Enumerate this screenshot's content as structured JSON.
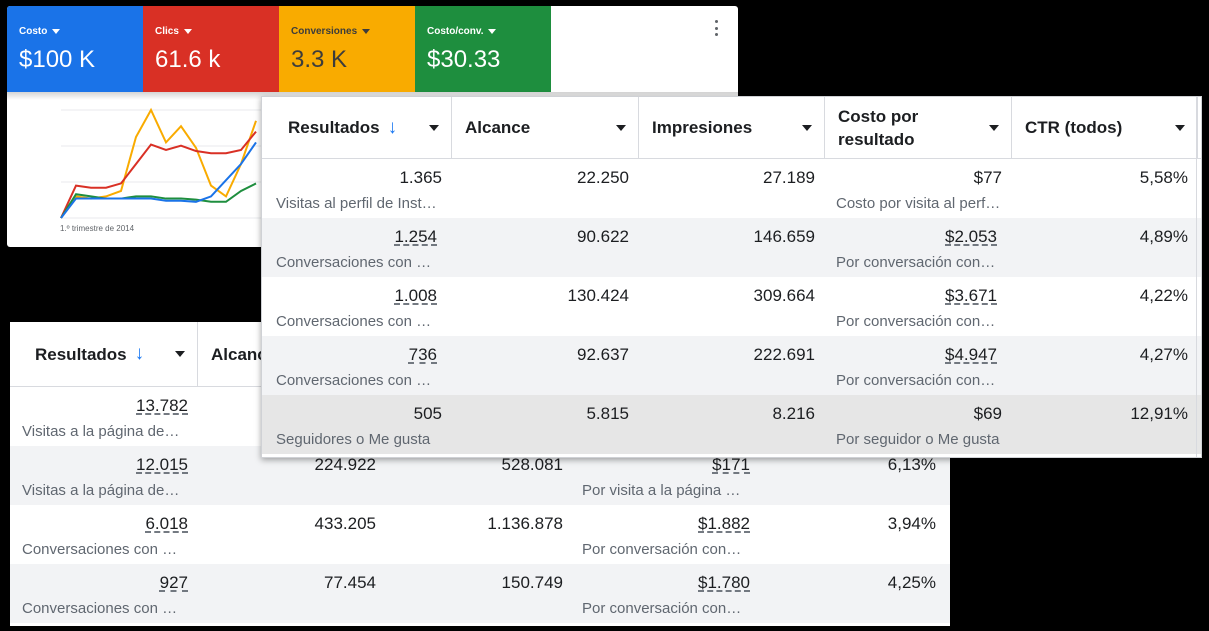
{
  "google_ads": {
    "metrics": [
      {
        "label": "Costo",
        "value": "$100 K",
        "color": "#1a73e8"
      },
      {
        "label": "Clics",
        "value": "61.6 k",
        "color": "#d93025"
      },
      {
        "label": "Conversiones",
        "value": "3.3 K",
        "color": "#f9ab00"
      },
      {
        "label": "Costo/conv.",
        "value": "$30.33",
        "color": "#1e8e3e"
      }
    ],
    "more_icon": "more-vert-icon",
    "quarter_label": "1.º trimestre de 2014",
    "chart_data": {
      "type": "line",
      "x": [
        1,
        2,
        3,
        4,
        5,
        6,
        7,
        8,
        9,
        10,
        11,
        12,
        13,
        14
      ],
      "series": [
        {
          "color": "#f9ab00",
          "values": [
            0,
            20,
            18,
            20,
            25,
            75,
            100,
            70,
            85,
            65,
            30,
            20,
            50,
            90
          ]
        },
        {
          "color": "#d93025",
          "values": [
            0,
            30,
            28,
            28,
            32,
            50,
            68,
            63,
            67,
            62,
            60,
            60,
            63,
            80
          ]
        },
        {
          "color": "#1e8e3e",
          "values": [
            0,
            22,
            20,
            18,
            18,
            20,
            20,
            18,
            18,
            17,
            15,
            15,
            25,
            32
          ]
        },
        {
          "color": "#1a73e8",
          "values": [
            0,
            18,
            18,
            18,
            18,
            18,
            18,
            16,
            16,
            15,
            20,
            35,
            50,
            70
          ]
        }
      ]
    }
  },
  "meta_back": {
    "header": {
      "results": "Resultados",
      "sort_arrow": "↓",
      "reach": "Alcance"
    },
    "rows": [
      {
        "results": "13.782",
        "results_sub": "Visitas a la página de destino",
        "reach": "",
        "impressions": "",
        "cost": "",
        "cost_sub": "",
        "ctr": ""
      },
      {
        "results": "12.015",
        "results_sub": "Visitas a la página de destino",
        "reach": "224.922",
        "impressions": "528.081",
        "cost": "$171",
        "cost_sub": "Por visita a la página de destino",
        "ctr": "6,13%"
      },
      {
        "results": "6.018",
        "results_sub": "Conversaciones con mensajes iniciadas",
        "reach": "433.205",
        "impressions": "1.136.878",
        "cost": "$1.882",
        "cost_sub": "Por conversación con mensajes iniciada",
        "ctr": "3,94%"
      },
      {
        "results": "927",
        "results_sub": "Conversaciones con mensajes iniciadas",
        "reach": "77.454",
        "impressions": "150.749",
        "cost": "$1.780",
        "cost_sub": "Por conversación con mensajes iniciada",
        "ctr": "4,25%"
      }
    ]
  },
  "meta_front": {
    "header": {
      "results": "Resultados",
      "sort_arrow": "↓",
      "reach": "Alcance",
      "impressions": "Impresiones",
      "cost_per_result_1": "Costo por",
      "cost_per_result_2": "resultado",
      "ctr": "CTR (todos)"
    },
    "rows": [
      {
        "results": "1.365",
        "results_sub": "Visitas al perfil de Instagram",
        "reach": "22.250",
        "impressions": "27.189",
        "cost": "$77",
        "cost_sub": "Costo por visita al perfil de Instagram",
        "ctr": "5,58%"
      },
      {
        "results": "1.254",
        "results_sub": "Conversaciones con mensajes iniciadas",
        "reach": "90.622",
        "impressions": "146.659",
        "cost": "$2.053",
        "cost_sub": "Por conversación con mensajes iniciada",
        "ctr": "4,89%"
      },
      {
        "results": "1.008",
        "results_sub": "Conversaciones con mensajes iniciadas",
        "reach": "130.424",
        "impressions": "309.664",
        "cost": "$3.671",
        "cost_sub": "Por conversación con mensajes iniciada",
        "ctr": "4,22%"
      },
      {
        "results": "736",
        "results_sub": "Conversaciones con mensajes iniciadas",
        "reach": "92.637",
        "impressions": "222.691",
        "cost": "$4.947",
        "cost_sub": "Por conversación con mensajes iniciada",
        "ctr": "4,27%"
      },
      {
        "results": "505",
        "results_sub": "Seguidores o Me gusta",
        "reach": "5.815",
        "impressions": "8.216",
        "cost": "$69",
        "cost_sub": "Por seguidor o Me gusta",
        "ctr": "12,91%"
      }
    ]
  }
}
